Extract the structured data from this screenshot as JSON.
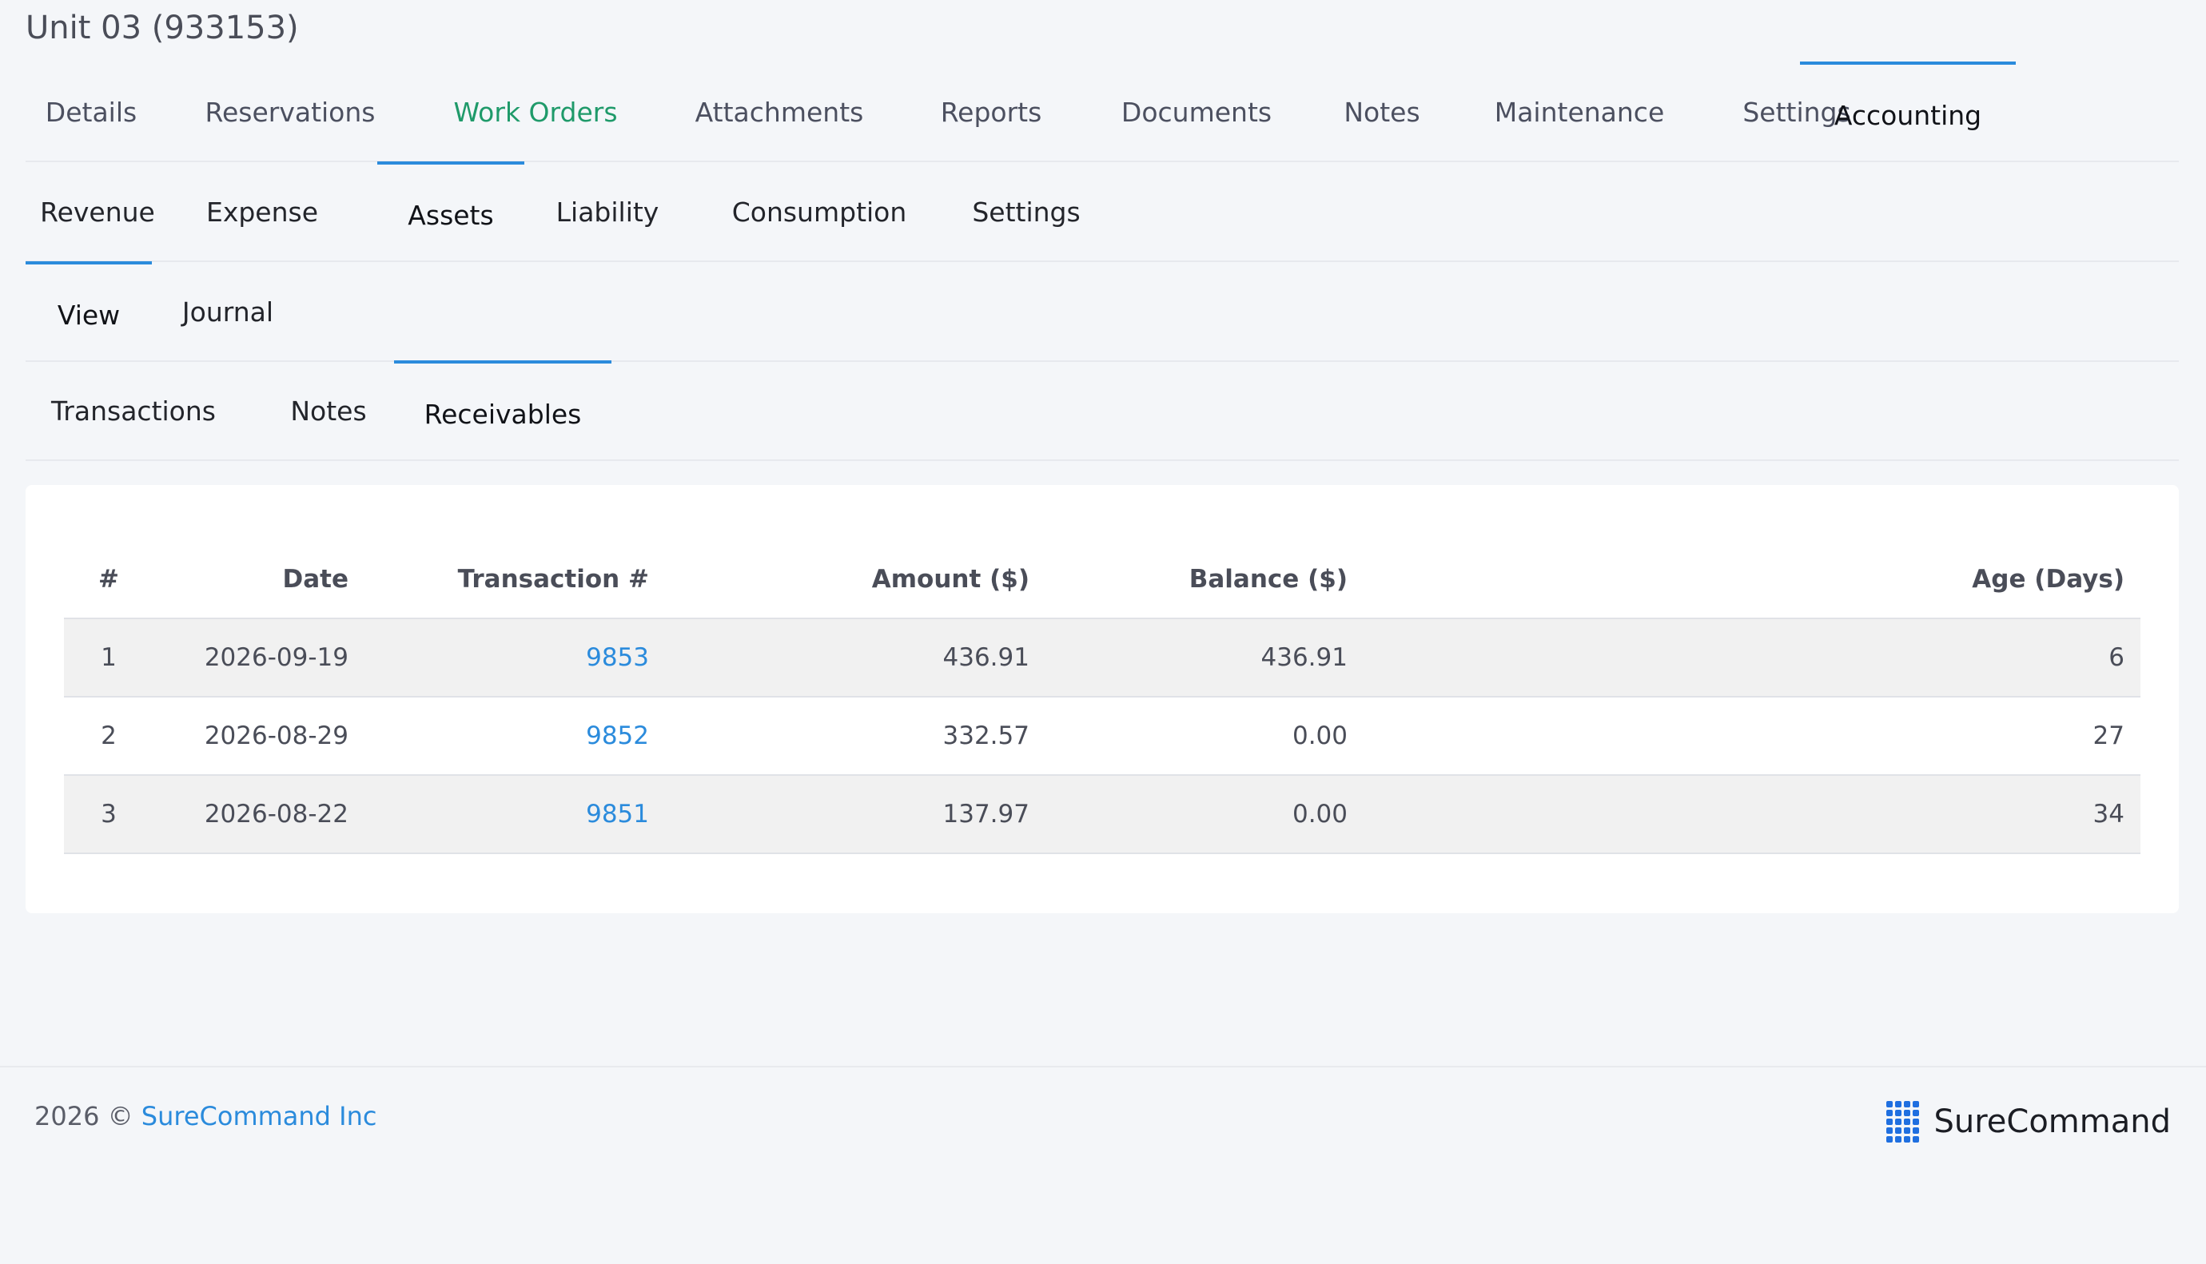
{
  "page": {
    "title": "Unit 03 (933153)"
  },
  "tabs_main": [
    {
      "label": "Details"
    },
    {
      "label": "Reservations"
    },
    {
      "label": "Work Orders"
    },
    {
      "label": "Attachments"
    },
    {
      "label": "Reports"
    },
    {
      "label": "Documents"
    },
    {
      "label": "Notes"
    },
    {
      "label": "Maintenance"
    },
    {
      "label": "Settings"
    },
    {
      "label": "Accounting"
    }
  ],
  "tabs_accounting": [
    {
      "label": "Revenue"
    },
    {
      "label": "Expense"
    },
    {
      "label": "Assets"
    },
    {
      "label": "Liability"
    },
    {
      "label": "Consumption"
    },
    {
      "label": "Settings"
    }
  ],
  "tabs_assets": [
    {
      "label": "View"
    },
    {
      "label": "Journal"
    }
  ],
  "tabs_view": [
    {
      "label": "Transactions"
    },
    {
      "label": "Notes"
    },
    {
      "label": "Receivables"
    }
  ],
  "table": {
    "headers": [
      "#",
      "Date",
      "Transaction #",
      "Amount ($)",
      "Balance ($)",
      "Age (Days)"
    ],
    "rows": [
      {
        "num": "1",
        "date": "2026-09-19",
        "txn": "9853",
        "amount": "436.91",
        "balance": "436.91",
        "age": "6"
      },
      {
        "num": "2",
        "date": "2026-08-29",
        "txn": "9852",
        "amount": "332.57",
        "balance": "0.00",
        "age": "27"
      },
      {
        "num": "3",
        "date": "2026-08-22",
        "txn": "9851",
        "amount": "137.97",
        "balance": "0.00",
        "age": "34"
      }
    ]
  },
  "footer": {
    "year": "2026 ©",
    "company_link": "SureCommand Inc",
    "brand_name": "SureCommand"
  },
  "colors": {
    "accent": "#2b8bdc",
    "work_orders_tab": "#1f9a6a",
    "brand_icon": "#1f6fe0"
  }
}
